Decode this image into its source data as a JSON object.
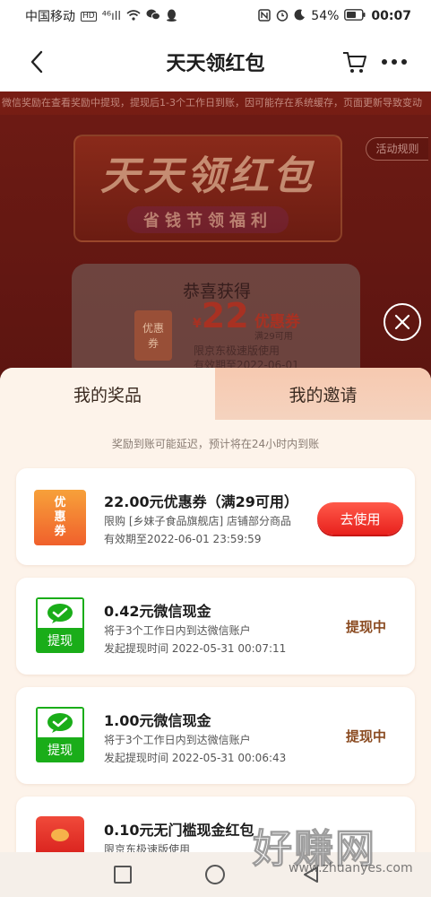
{
  "status_bar": {
    "carrier": "中国移动",
    "hd": "HD",
    "signal": "⁴⁶ıll",
    "battery": "54%",
    "time": "00:07"
  },
  "header": {
    "title": "天天领红包"
  },
  "background": {
    "notice": "微信奖励在查看奖励中提现，提现后1-3个工作日到账，因可能存在系统缓存，页面更新导致变动",
    "rules_label": "活动规则",
    "hero_title": "天天领红包",
    "hero_subtitle": "省钱节领福利",
    "win_title": "恭喜获得",
    "win_tag_line1": "优惠",
    "win_tag_line2": "券",
    "win_currency": "¥",
    "win_amount": "22",
    "win_unit": "优惠券",
    "win_min": "满29可用",
    "win_limit": "限京东极速版使用",
    "win_valid": "有效期至2022-06-01"
  },
  "sheet": {
    "tabs": [
      {
        "label": "我的奖品",
        "active": true
      },
      {
        "label": "我的邀请",
        "active": false
      }
    ],
    "note": "奖励到账可能延迟，预计将在24小时内到账",
    "coupon": {
      "icon_line1": "优",
      "icon_line2": "惠",
      "icon_line3": "券",
      "title": "22.00元优惠券（满29可用）",
      "line1": "限购 [乡妹子食品旗舰店] 店铺部分商品",
      "line2": "有效期至2022-06-01 23:59:59",
      "button": "去使用"
    },
    "cash1": {
      "icon_label": "提现",
      "title": "0.42元微信现金",
      "line1": "将于3个工作日内到达微信账户",
      "line2": "发起提现时间 2022-05-31 00:07:11",
      "status": "提现中"
    },
    "cash2": {
      "icon_label": "提现",
      "title": "1.00元微信现金",
      "line1": "将于3个工作日内到达微信账户",
      "line2": "发起提现时间 2022-05-31 00:06:43",
      "status": "提现中"
    },
    "redpack": {
      "title": "0.10元无门槛现金红包",
      "line1": "限京东极速版使用"
    }
  },
  "watermark": {
    "big": "好赚网",
    "small": "www.zhuanyes.com"
  },
  "colors": {
    "accent_red": "#e8211d",
    "wechat_green": "#1aad19",
    "status_brown": "#8a4a20",
    "sheet_bg": "#fdf3ea"
  }
}
